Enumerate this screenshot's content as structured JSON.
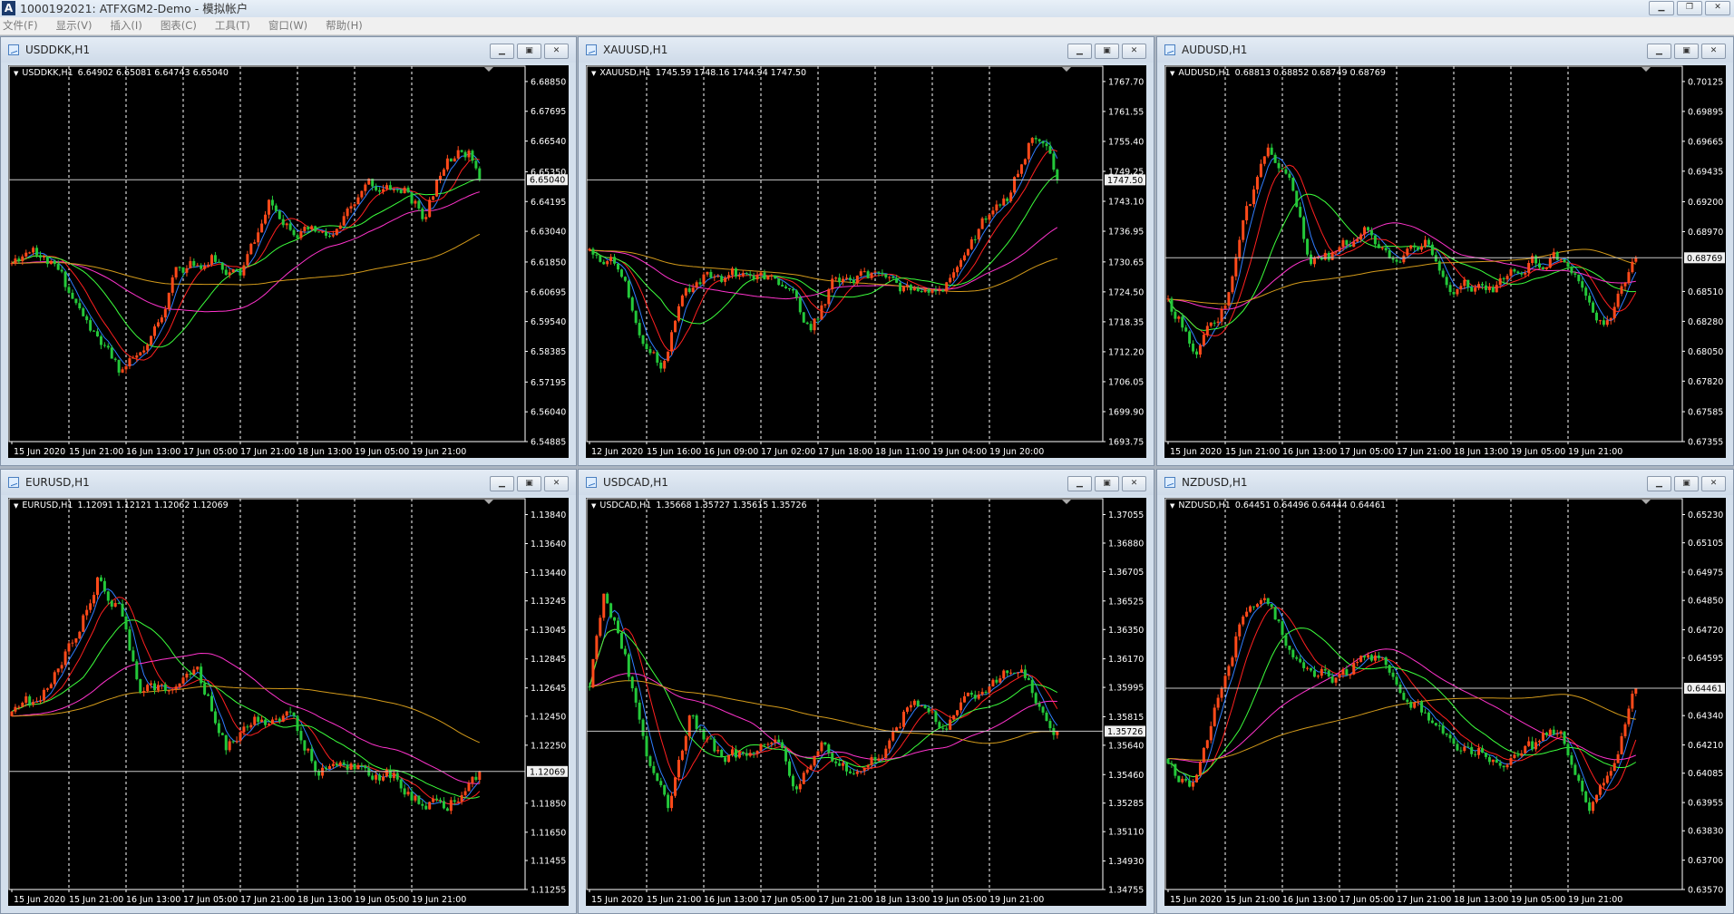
{
  "app": {
    "title": "1000192021: ATFXGM2-Demo - 模拟帐户",
    "logo": "A",
    "controls": [
      "minimize",
      "restore",
      "close"
    ],
    "menu": [
      "文件(F)",
      "显示(V)",
      "插入(I)",
      "图表(C)",
      "工具(T)",
      "窗口(W)",
      "帮助(H)"
    ]
  },
  "colors": {
    "bull": "#ff4a1a",
    "bear": "#24c83a",
    "background": "#000000",
    "ma": [
      "#2f7dff",
      "#ff2020",
      "#3cff3c",
      "#ff33cc",
      "#d39a1a"
    ]
  },
  "ma_periods": [
    5,
    10,
    21,
    45,
    100
  ],
  "charts": [
    {
      "window_title": "USDDKK,H1",
      "symbol_tf": "USDDKK,H1",
      "ohlc": "6.64902 6.65081 6.64743 6.65040",
      "current_price": "6.65040",
      "decimals": 5,
      "seed": 11,
      "y_ticks": [
        "6.68850",
        "6.67695",
        "6.66540",
        "6.65350",
        "6.64195",
        "6.63040",
        "6.61850",
        "6.60695",
        "6.59540",
        "6.58385",
        "6.57195",
        "6.56040",
        "6.54885"
      ],
      "x_ticks": [
        "15 Jun 2020",
        "15 Jun 21:00",
        "16 Jun 13:00",
        "17 Jun 05:00",
        "17 Jun 21:00",
        "18 Jun 13:00",
        "19 Jun 05:00",
        "19 Jun 21:00"
      ],
      "price_path": [
        [
          0,
          6.618
        ],
        [
          6,
          6.626
        ],
        [
          14,
          6.612
        ],
        [
          22,
          6.592
        ],
        [
          30,
          6.576
        ],
        [
          38,
          6.583
        ],
        [
          46,
          6.615
        ],
        [
          56,
          6.62
        ],
        [
          64,
          6.613
        ],
        [
          72,
          6.64
        ],
        [
          82,
          6.63
        ],
        [
          90,
          6.627
        ],
        [
          100,
          6.648
        ],
        [
          110,
          6.646
        ],
        [
          116,
          6.636
        ],
        [
          122,
          6.662
        ],
        [
          128,
          6.662
        ],
        [
          131,
          6.6504
        ]
      ]
    },
    {
      "window_title": "XAUUSD,H1",
      "symbol_tf": "XAUUSD,H1",
      "ohlc": "1745.59 1748.16 1744.94 1747.50",
      "current_price": "1747.50",
      "decimals": 2,
      "seed": 22,
      "y_ticks": [
        "1767.70",
        "1761.55",
        "1755.40",
        "1749.25",
        "1743.10",
        "1736.95",
        "1730.65",
        "1724.50",
        "1718.35",
        "1712.20",
        "1706.05",
        "1699.90",
        "1693.75"
      ],
      "x_ticks": [
        "12 Jun 2020",
        "15 Jun 16:00",
        "16 Jun 09:00",
        "17 Jun 02:00",
        "17 Jun 18:00",
        "18 Jun 11:00",
        "19 Jun 04:00",
        "19 Jun 20:00"
      ],
      "price_path": [
        [
          0,
          1733
        ],
        [
          8,
          1731
        ],
        [
          14,
          1718
        ],
        [
          20,
          1709
        ],
        [
          26,
          1724
        ],
        [
          34,
          1728
        ],
        [
          44,
          1728
        ],
        [
          52,
          1726
        ],
        [
          58,
          1724
        ],
        [
          62,
          1716
        ],
        [
          68,
          1726
        ],
        [
          80,
          1728
        ],
        [
          92,
          1724
        ],
        [
          102,
          1727
        ],
        [
          110,
          1738
        ],
        [
          118,
          1745
        ],
        [
          124,
          1756
        ],
        [
          128,
          1752
        ],
        [
          131,
          1747.5
        ]
      ]
    },
    {
      "window_title": "AUDUSD,H1",
      "symbol_tf": "AUDUSD,H1",
      "ohlc": "0.68813 0.68852 0.68749 0.68769",
      "current_price": "0.68769",
      "decimals": 5,
      "seed": 33,
      "y_ticks": [
        "0.70125",
        "0.69895",
        "0.69665",
        "0.69435",
        "0.69200",
        "0.68970",
        "0.68510",
        "0.68280",
        "0.68050",
        "0.67820",
        "0.67585",
        "0.67355"
      ],
      "x_ticks": [
        "15 Jun 2020",
        "15 Jun 21:00",
        "16 Jun 13:00",
        "17 Jun 05:00",
        "17 Jun 21:00",
        "18 Jun 13:00",
        "19 Jun 05:00",
        "19 Jun 21:00"
      ],
      "price_path": [
        [
          0,
          0.6845
        ],
        [
          8,
          0.6805
        ],
        [
          16,
          0.684
        ],
        [
          22,
          0.691
        ],
        [
          28,
          0.696
        ],
        [
          34,
          0.693
        ],
        [
          40,
          0.687
        ],
        [
          48,
          0.688
        ],
        [
          56,
          0.69
        ],
        [
          64,
          0.6875
        ],
        [
          72,
          0.689
        ],
        [
          80,
          0.6855
        ],
        [
          92,
          0.6855
        ],
        [
          100,
          0.687
        ],
        [
          108,
          0.688
        ],
        [
          116,
          0.6855
        ],
        [
          122,
          0.6825
        ],
        [
          128,
          0.6855
        ],
        [
          131,
          0.68769
        ]
      ]
    },
    {
      "window_title": "EURUSD,H1",
      "symbol_tf": "EURUSD,H1",
      "ohlc": "1.12091 1.12121 1.12062 1.12069",
      "current_price": "1.12069",
      "decimals": 5,
      "seed": 44,
      "y_ticks": [
        "1.13840",
        "1.13640",
        "1.13440",
        "1.13245",
        "1.13045",
        "1.12845",
        "1.12645",
        "1.12450",
        "1.12250",
        "1.11850",
        "1.11650",
        "1.11455",
        "1.11255"
      ],
      "x_ticks": [
        "15 Jun 2020",
        "15 Jun 21:00",
        "16 Jun 13:00",
        "17 Jun 05:00",
        "17 Jun 21:00",
        "18 Jun 13:00",
        "19 Jun 05:00",
        "19 Jun 21:00"
      ],
      "price_path": [
        [
          0,
          1.1245
        ],
        [
          9,
          1.126
        ],
        [
          18,
          1.13
        ],
        [
          24,
          1.134
        ],
        [
          30,
          1.132
        ],
        [
          36,
          1.1265
        ],
        [
          45,
          1.1265
        ],
        [
          52,
          1.1275
        ],
        [
          60,
          1.1225
        ],
        [
          68,
          1.124
        ],
        [
          78,
          1.1245
        ],
        [
          86,
          1.1205
        ],
        [
          96,
          1.121
        ],
        [
          106,
          1.1205
        ],
        [
          114,
          1.1188
        ],
        [
          122,
          1.118
        ],
        [
          127,
          1.1195
        ],
        [
          131,
          1.12069
        ]
      ]
    },
    {
      "window_title": "USDCAD,H1",
      "symbol_tf": "USDCAD,H1",
      "ohlc": "1.35668 1.35727 1.35615 1.35726",
      "current_price": "1.35726",
      "decimals": 5,
      "seed": 55,
      "y_ticks": [
        "1.37055",
        "1.36880",
        "1.36705",
        "1.36525",
        "1.36350",
        "1.36170",
        "1.35995",
        "1.35815",
        "1.35640",
        "1.35460",
        "1.35285",
        "1.35110",
        "1.34930",
        "1.34755"
      ],
      "x_ticks": [
        "15 Jun 2020",
        "15 Jun 21:00",
        "16 Jun 13:00",
        "17 Jun 05:00",
        "17 Jun 21:00",
        "18 Jun 13:00",
        "19 Jun 05:00",
        "19 Jun 21:00"
      ],
      "price_path": [
        [
          0,
          1.36
        ],
        [
          4,
          1.366
        ],
        [
          10,
          1.362
        ],
        [
          16,
          1.356
        ],
        [
          22,
          1.353
        ],
        [
          28,
          1.358
        ],
        [
          36,
          1.356
        ],
        [
          44,
          1.3555
        ],
        [
          52,
          1.357
        ],
        [
          58,
          1.3535
        ],
        [
          66,
          1.3565
        ],
        [
          74,
          1.3545
        ],
        [
          82,
          1.356
        ],
        [
          90,
          1.359
        ],
        [
          98,
          1.3575
        ],
        [
          106,
          1.359
        ],
        [
          114,
          1.36
        ],
        [
          120,
          1.3615
        ],
        [
          126,
          1.359
        ],
        [
          131,
          1.35726
        ]
      ]
    },
    {
      "window_title": "NZDUSD,H1",
      "symbol_tf": "NZDUSD,H1",
      "ohlc": "0.64451 0.64496 0.64444 0.64461",
      "current_price": "0.64461",
      "decimals": 5,
      "seed": 66,
      "y_ticks": [
        "0.65230",
        "0.65105",
        "0.64975",
        "0.64850",
        "0.64720",
        "0.64595",
        "0.64340",
        "0.64210",
        "0.64085",
        "0.63955",
        "0.63830",
        "0.63700",
        "0.63570"
      ],
      "x_ticks": [
        "15 Jun 2020",
        "15 Jun 21:00",
        "16 Jun 13:00",
        "17 Jun 05:00",
        "17 Jun 21:00",
        "18 Jun 13:00",
        "19 Jun 05:00",
        "19 Jun 21:00"
      ],
      "price_path": [
        [
          0,
          0.6415
        ],
        [
          6,
          0.64
        ],
        [
          14,
          0.644
        ],
        [
          20,
          0.6475
        ],
        [
          26,
          0.649
        ],
        [
          32,
          0.647
        ],
        [
          40,
          0.6455
        ],
        [
          48,
          0.645
        ],
        [
          56,
          0.6462
        ],
        [
          64,
          0.645
        ],
        [
          72,
          0.6435
        ],
        [
          82,
          0.642
        ],
        [
          92,
          0.6415
        ],
        [
          102,
          0.642
        ],
        [
          110,
          0.643
        ],
        [
          118,
          0.6395
        ],
        [
          124,
          0.641
        ],
        [
          131,
          0.64461
        ]
      ]
    }
  ]
}
